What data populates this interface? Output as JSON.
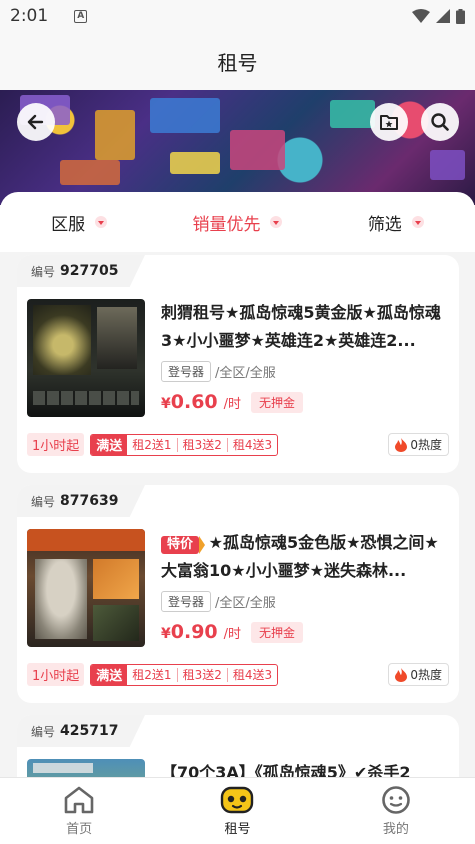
{
  "status": {
    "time": "2:01"
  },
  "header": {
    "title": "租号"
  },
  "filters": {
    "region": "区服",
    "sort": "销量优先",
    "filter": "筛选"
  },
  "colors": {
    "accent": "#e8404d",
    "deposit_bg": "#fde7e8",
    "active_tab_yellow": "#f5c518"
  },
  "cards": [
    {
      "no_label": "编号",
      "no": "927705",
      "special_tag": "",
      "title": "刺猬租号★孤岛惊魂5黄金版★孤岛惊魂3★小小噩梦★英雄连2★英雄连2...",
      "login_tool": "登号器",
      "region": "/全区/全服",
      "price_yen": "¥",
      "price": "0.60",
      "per": "/时",
      "deposit": "无押金",
      "min_rent": "1小时起",
      "promo_lead": "满送",
      "promo_items": [
        "租2送1",
        "租3送2",
        "租4送3"
      ],
      "heat": "0热度"
    },
    {
      "no_label": "编号",
      "no": "877639",
      "special_tag": "特价",
      "title": "★孤岛惊魂5金色版★恐惧之间★大富翁10★小小噩梦★迷失森林...",
      "login_tool": "登号器",
      "region": "/全区/全服",
      "price_yen": "¥",
      "price": "0.90",
      "per": "/时",
      "deposit": "无押金",
      "min_rent": "1小时起",
      "promo_lead": "满送",
      "promo_items": [
        "租2送1",
        "租3送2",
        "租4送3"
      ],
      "heat": "0热度"
    },
    {
      "no_label": "编号",
      "no": "425717",
      "title": "【70个3A】《孤岛惊魂5》✔杀手2"
    }
  ],
  "tabs": {
    "home": "首页",
    "rent": "租号",
    "mine": "我的"
  }
}
